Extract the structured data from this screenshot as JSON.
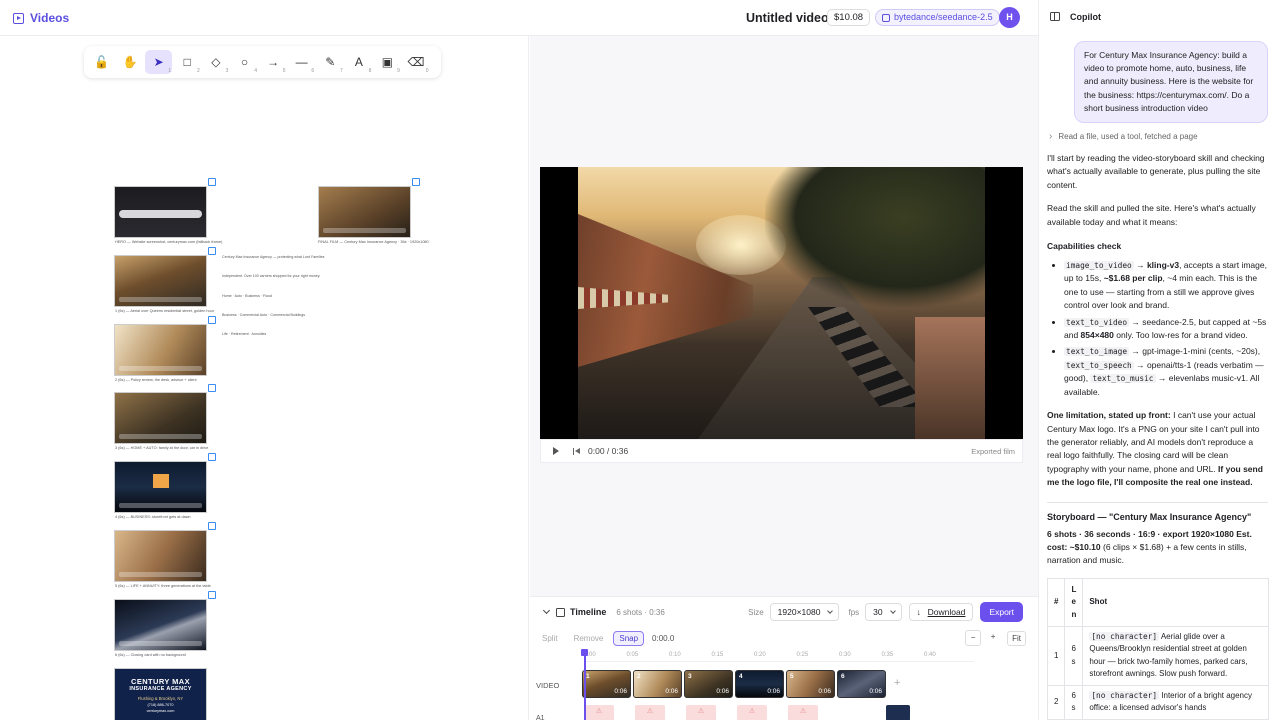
{
  "header": {
    "brand": "Videos",
    "title": "Untitled video",
    "cost": "$10.08",
    "model": "bytedance/seedance-2.5",
    "avatar": "H"
  },
  "tools": [
    {
      "name": "lock-icon",
      "glyph": "🔓",
      "n": ""
    },
    {
      "name": "hand-icon",
      "glyph": "✋",
      "n": ""
    },
    {
      "name": "pointer-icon",
      "glyph": "➤",
      "n": "1"
    },
    {
      "name": "rectangle-icon",
      "glyph": "□",
      "n": "2"
    },
    {
      "name": "diamond-icon",
      "glyph": "◇",
      "n": "3"
    },
    {
      "name": "circle-icon",
      "glyph": "○",
      "n": "4"
    },
    {
      "name": "arrow-icon",
      "glyph": "→",
      "n": "5"
    },
    {
      "name": "line-icon",
      "glyph": "—",
      "n": "6"
    },
    {
      "name": "pencil-icon",
      "glyph": "✎",
      "n": "7"
    },
    {
      "name": "text-icon",
      "glyph": "A",
      "n": "8"
    },
    {
      "name": "image-icon",
      "glyph": "▣",
      "n": "9"
    },
    {
      "name": "eraser-icon",
      "glyph": "⌫",
      "n": "0"
    }
  ],
  "canvas": {
    "captions": [
      "HERO — Website screenshot, centurymax.com (fallback frame)",
      "1 (6s) — Aerial over Queens residential street, golden hour",
      "2 (6s) — Policy review, the desk, advisor + client",
      "3 (6s) — HOME + AUTO: family at the door, car in drive",
      "4 (6s) — BUSINESS: storefront gets at dawn",
      "5 (6s) — LIFE + ANNUITY: three generations at the table",
      "6 (6s) — Closing card with no background",
      "FINAL FILM — Century Max Insurance Agency · 36s · 1920x1080"
    ],
    "notes": [
      "Century Max Insurance Agency — protecting what Lord Families",
      "Independent. Over 100 carriers shopped for your right money.",
      "Home · Auto · Business · Flood",
      "Business · Commercial Auto · Commercial Buildings",
      "Life · Retirement · Annuities"
    ],
    "card": {
      "l1": "CENTURY MAX",
      "l2": "INSURANCE AGENCY",
      "l3": "Flushing & Brooklyn, NY",
      "l4": "(718) 886-7070",
      "l5": "centurymax.com"
    }
  },
  "player": {
    "time": "0:00 / 0:36",
    "label": "Exported film"
  },
  "timeline": {
    "title": "Timeline",
    "sub": "6 shots · 0:36",
    "size_label": "Size",
    "size": "1920×1080",
    "fps_label": "fps",
    "fps": "30",
    "download": "Download",
    "export": "Export",
    "split": "Split",
    "remove": "Remove",
    "snap": "Snap",
    "timecode": "0:00.0",
    "zoom_out": "−",
    "zoom_in": "+",
    "fit": "Fit",
    "ruler": [
      "0:00",
      "0:05",
      "0:10",
      "0:15",
      "0:20",
      "0:25",
      "0:30",
      "0:35",
      "0:40"
    ],
    "video_label": "VIDEO",
    "audio_label": "A1",
    "clips": [
      {
        "n": "1",
        "d": "0:06"
      },
      {
        "n": "2",
        "d": "0:06"
      },
      {
        "n": "3",
        "d": "0:06"
      },
      {
        "n": "4",
        "d": "0:06"
      },
      {
        "n": "5",
        "d": "0:06"
      },
      {
        "n": "6",
        "d": "0:06"
      }
    ]
  },
  "copilot": {
    "title": "Copilot",
    "user_msg": "For Century Max Insurance Agency: build a video to promote home, auto, business, life and annuity business. Here is the website for the business: https://centurymax.com/. Do a short business introduction video",
    "used": "Read a file, used a tool, fetched a page",
    "p1": "I'll start by reading the video-storyboard skill and checking what's actually available to generate, plus pulling the site content.",
    "p2": "Read the skill and pulled the site. Here's what's actually available today and what it means:",
    "cap_title": "Capabilities check",
    "b1_code": "image_to_video",
    "b1_model": "kling-v3",
    "b1_a": ", accepts a start image, up to 15s, ",
    "b1_price": "~$1.68 per clip",
    "b1_b": ", ~4 min each. This is the one to use — starting from a still we approve gives control over look and brand.",
    "b2_code": "text_to_video",
    "b2_a": " → seedance-2.5, but capped at ~5s and ",
    "b2_res": "854×480",
    "b2_b": " only. Too low-res for a brand video.",
    "b3_code1": "text_to_image",
    "b3_a": " → gpt-image-1-mini (cents, ~20s), ",
    "b3_code2": "text_to_speech",
    "b3_b": " → openai/tts-1 (reads verbatim — good), ",
    "b3_code3": "text_to_music",
    "b3_c": " → elevenlabs music-v1. All available.",
    "lim_bold": "One limitation, stated up front:",
    "lim_text": " I can't use your actual Century Max logo. It's a PNG on your site I can't pull into the generator reliably, and AI models don't reproduce a real logo faithfully. The closing card will be clean typography with your name, phone and URL. ",
    "lim_bold2": "If you send me the logo file, I'll composite the real one instead.",
    "sb_title": "Storyboard — \"Century Max Insurance Agency\"",
    "sb_meta_bold": "6 shots · 36 seconds · 16:9 · export 1920×1080 Est. cost: ~$10.10",
    "sb_meta": " (6 clips × $1.68) + a few cents in stills, narration and music.",
    "th_num": "#",
    "th_len": "Len",
    "th_shot": "Shot",
    "r1_num": "1",
    "r1_len": "6s",
    "r1_code": "[no character]",
    "r1_text": " Aerial glide over a Queens/Brooklyn residential street at golden hour — brick two-family homes, parked cars, storefront awnings. Slow push forward.",
    "r2_num": "2",
    "r2_len": "6s",
    "r2_code": "[no character]",
    "r2_text": " Interior of a bright agency office: a licensed advisor's hands"
  }
}
